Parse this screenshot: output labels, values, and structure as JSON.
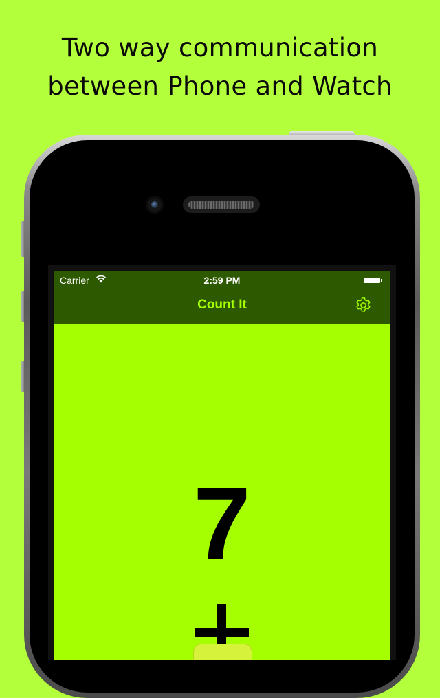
{
  "headline": {
    "line1": "Two way communication",
    "line2": "between Phone and Watch"
  },
  "status_bar": {
    "carrier": "Carrier",
    "time": "2:59 PM",
    "wifi_icon": "wifi-icon",
    "battery_icon": "battery-icon"
  },
  "nav": {
    "title": "Count It",
    "settings_icon": "gear-icon"
  },
  "counter": {
    "value": "7",
    "increment_icon": "plus-icon"
  },
  "colors": {
    "page_background": "#b4ff3b",
    "screen_background": "#a5ff00",
    "navbar_background": "#2d5a00",
    "accent": "#a5ff00"
  }
}
